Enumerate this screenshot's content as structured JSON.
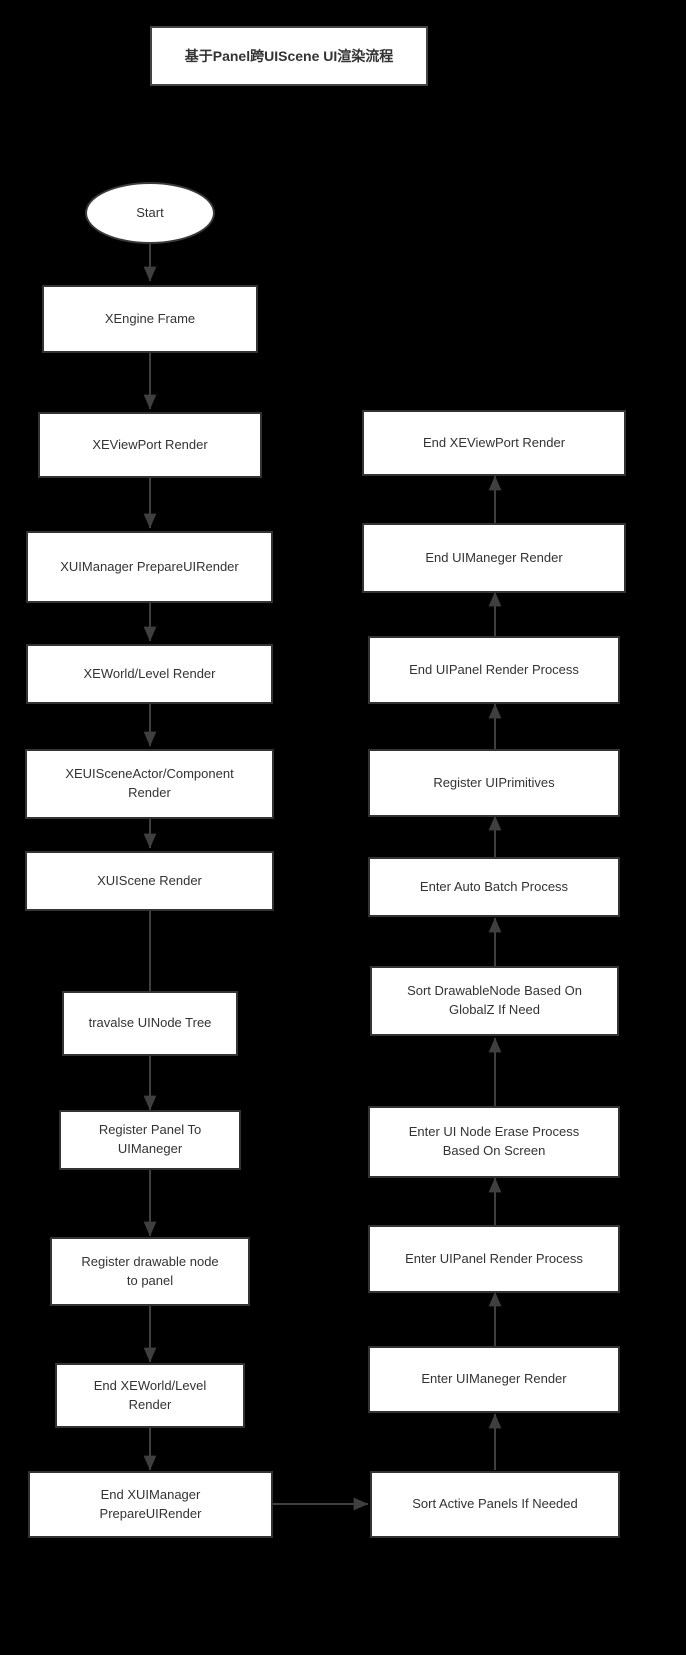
{
  "diagram": {
    "title": "基于Panel跨UIScene UI渲染流程",
    "background_color": "#000000",
    "node_fill_color": "#ffffff",
    "node_border_color": "#333333",
    "edge_color": "#3f3f3f",
    "text_color": "#333333"
  },
  "nodes": {
    "title": "基于Panel跨UIScene UI渲染流程",
    "start": "Start",
    "xengine_frame": "XEngine Frame",
    "xeviewport_render": "XEViewPort Render",
    "xuimanager_prepareuirender": "XUIManager PrepareUIRender",
    "xeworld_level_render": "XEWorld/Level Render",
    "xeuisceneactor_component_render": "XEUISceneActor/Component\nRender",
    "xuiscene_render": "XUIScene Render",
    "travalse_uinode_tree": "travalse UINode Tree",
    "register_panel_to_uimaneger": "Register Panel To\nUIManeger",
    "register_drawable_node_to_panel": "Register drawable node\nto panel",
    "end_xeworld_level_render": "End XEWorld/Level\nRender",
    "end_xuimanager_prepareuirender": "End XUIManager\nPrepareUIRender",
    "sort_active_panels_if_needed": "Sort Active Panels If Needed",
    "enter_uimaneger_render": "Enter UIManeger Render",
    "enter_uipanel_render_process": "Enter UIPanel Render Process",
    "enter_ui_node_erase_process": "Enter UI Node Erase Process\nBased On Screen",
    "sort_drawablenode_globalz": "Sort DrawableNode Based On\nGlobalZ If Need",
    "enter_auto_batch_process": "Enter Auto Batch Process",
    "register_uiprimitives": "Register UIPrimitives",
    "end_uipanel_render_process": "End UIPanel Render Process",
    "end_uimaneger_render": "End UIManeger Render",
    "end_xeviewport_render": "End XEViewPort Render"
  }
}
